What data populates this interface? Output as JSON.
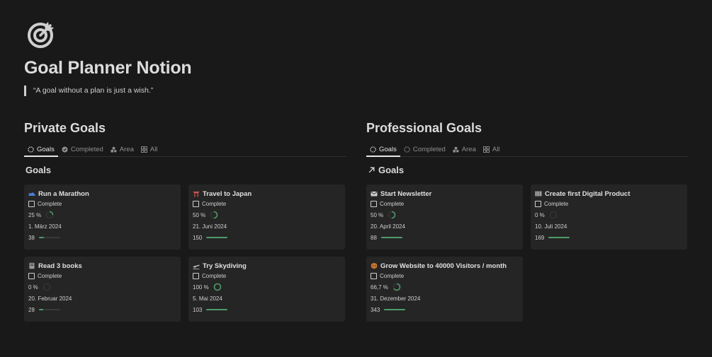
{
  "page": {
    "title": "Goal Planner Notion",
    "quote": "“A goal without a plan is just a wish.”"
  },
  "private": {
    "title": "Private Goals",
    "tabs": [
      "Goals",
      "Completed",
      "Area",
      "All"
    ],
    "view_title": "Goals",
    "cards": [
      {
        "icon": "running-shoe-icon",
        "color": "#4a7fd6",
        "title": "Run a Marathon",
        "complete_label": "Complete",
        "percent": "25 %",
        "progress": 0.25,
        "date": "1. März 2024",
        "count": "38",
        "bar": 0.25
      },
      {
        "icon": "shrine-icon",
        "color": "#d9534f",
        "title": "Travel to Japan",
        "complete_label": "Complete",
        "percent": "50 %",
        "progress": 0.5,
        "date": "21. Juni 2024",
        "count": "150",
        "bar": 1.0
      },
      {
        "icon": "book-icon",
        "color": "#9a9a9a",
        "title": "Read 3 books",
        "complete_label": "Complete",
        "percent": "0 %",
        "progress": 0.0,
        "date": "20. Februar 2024",
        "count": "28",
        "bar": 0.2
      },
      {
        "icon": "airplane-icon",
        "color": "#cfcfcf",
        "title": "Try Skydiving",
        "complete_label": "Complete",
        "percent": "100 %",
        "progress": 1.0,
        "date": "5. Mai 2024",
        "count": "103",
        "bar": 1.0
      }
    ]
  },
  "professional": {
    "title": "Professional Goals",
    "tabs": [
      "Goals",
      "Completed",
      "Area",
      "All"
    ],
    "view_title": "Goals",
    "cards": [
      {
        "icon": "envelope-icon",
        "color": "#cfcfcf",
        "title": "Start Newsletter",
        "complete_label": "Complete",
        "percent": "50 %",
        "progress": 0.5,
        "date": "20. April 2024",
        "count": "88",
        "bar": 1.0
      },
      {
        "icon": "barcode-icon",
        "color": "#cfcfcf",
        "title": "Create first Digital Product",
        "complete_label": "Complete",
        "percent": "0 %",
        "progress": 0.0,
        "date": "10. Juli 2024",
        "count": "169",
        "bar": 1.0
      },
      {
        "icon": "globe-icon",
        "color": "#e08a3c",
        "title": "Grow Website to 40000 Visitors / month",
        "complete_label": "Complete",
        "percent": "66,7 %",
        "progress": 0.667,
        "date": "31. Dezember 2024",
        "count": "343",
        "bar": 1.0
      }
    ]
  },
  "colors": {
    "background": "#191919",
    "card": "#252525",
    "accent": "#4f9a6a"
  }
}
